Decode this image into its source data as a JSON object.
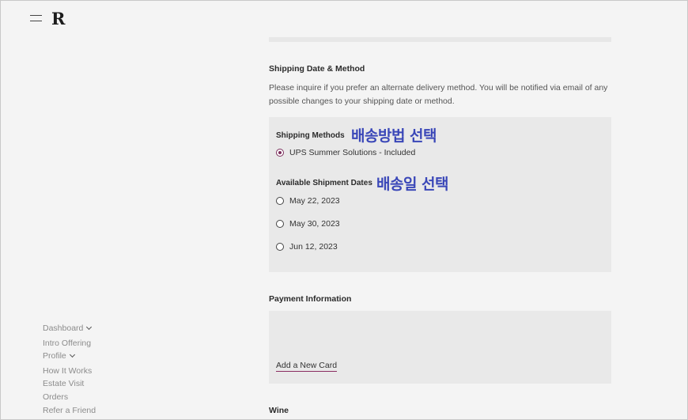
{
  "header": {
    "logo_text": "R",
    "menu_icon": "hamburger-menu-icon"
  },
  "shipping": {
    "title": "Shipping Date & Method",
    "description": "Please inquire if you prefer an alternate delivery method. You will be notified via email of any possible changes to your shipping date or method.",
    "methods_label": "Shipping Methods",
    "methods_annotation": "배송방법 선택",
    "methods": [
      {
        "label": "UPS Summer Solutions - Included",
        "selected": true
      }
    ],
    "dates_label": "Available Shipment Dates",
    "dates_annotation": "배송일 선택",
    "dates": [
      {
        "label": "May 22, 2023",
        "selected": false
      },
      {
        "label": "May 30, 2023",
        "selected": false
      },
      {
        "label": "Jun 12, 2023",
        "selected": false
      }
    ]
  },
  "payment": {
    "title": "Payment Information",
    "add_card_label": "Add a New Card"
  },
  "wine": {
    "title": "Wine"
  },
  "sidebar": {
    "items": [
      {
        "label": "Dashboard",
        "has_dropdown": true
      },
      {
        "label": "Intro Offering",
        "has_dropdown": false
      },
      {
        "label": "Profile",
        "has_dropdown": true
      },
      {
        "label": "How It Works",
        "has_dropdown": false
      },
      {
        "label": "Estate Visit",
        "has_dropdown": false
      },
      {
        "label": "Orders",
        "has_dropdown": false
      },
      {
        "label": "Refer a Friend",
        "has_dropdown": false
      }
    ]
  },
  "colors": {
    "accent": "#7b2e5c",
    "annotation": "#3a47b8",
    "panel_bg": "#e9e9e9",
    "page_bg": "#f4f4f4"
  }
}
